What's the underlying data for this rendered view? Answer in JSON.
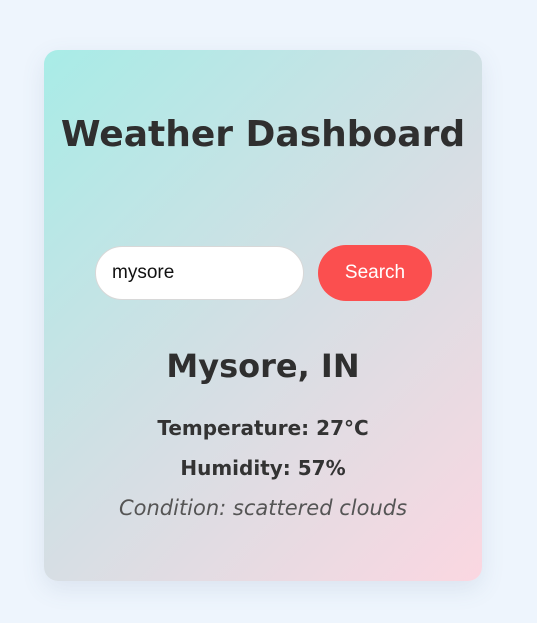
{
  "header": {
    "title": "Weather Dashboard"
  },
  "search": {
    "value": "mysore",
    "placeholder": "",
    "button_label": "Search"
  },
  "weather": {
    "city": "Mysore, IN",
    "temperature": "Temperature: 27°C",
    "humidity": "Humidity: 57%",
    "condition": "Condition: scattered clouds"
  }
}
